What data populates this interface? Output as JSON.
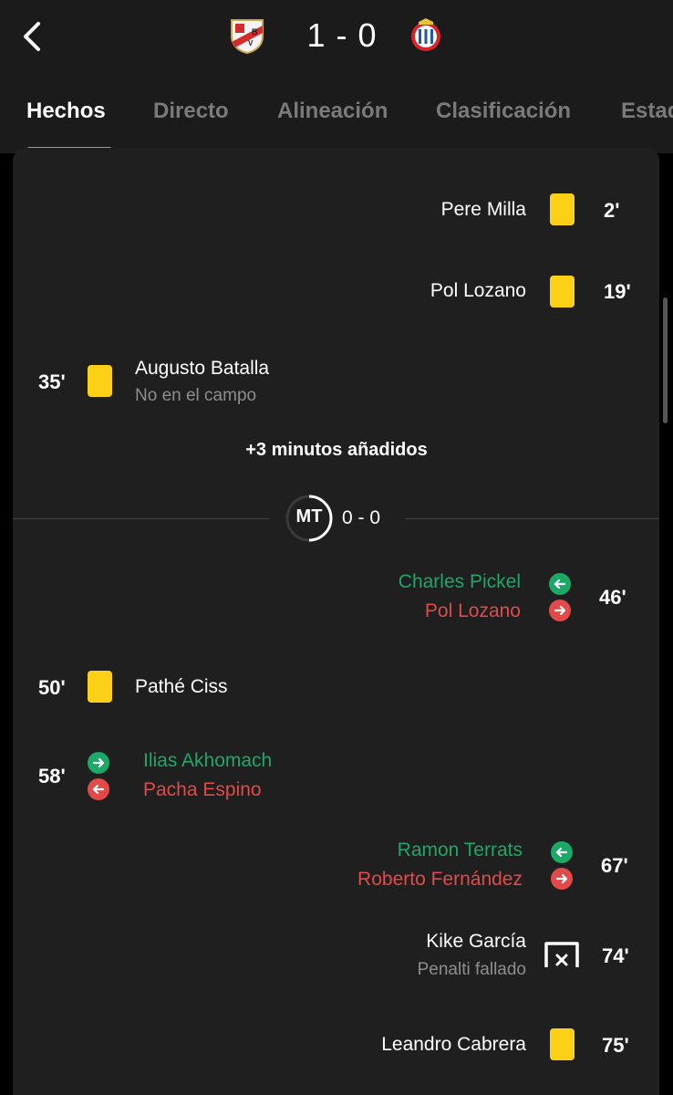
{
  "match": {
    "score": "1 - 0",
    "home_crest": "rayo-vallecano-crest-icon",
    "away_crest": "espanyol-crest-icon"
  },
  "tabs": [
    {
      "label": "Hechos",
      "active": true
    },
    {
      "label": "Directo"
    },
    {
      "label": "Alineación"
    },
    {
      "label": "Clasificación"
    },
    {
      "label": "Estad"
    }
  ],
  "events": {
    "e1": {
      "minute": "2'",
      "player": "Pere Milla",
      "type": "yellow-card",
      "side": "away"
    },
    "e2": {
      "minute": "19'",
      "player": "Pol Lozano",
      "type": "yellow-card",
      "side": "away"
    },
    "e3": {
      "minute": "35'",
      "player": "Augusto Batalla",
      "note": "No en el campo",
      "type": "yellow-card",
      "side": "home"
    },
    "added_time": "+3 minutos añadidos",
    "halftime": {
      "label": "MT",
      "score": "0 - 0"
    },
    "e4": {
      "minute": "46'",
      "player_in": "Charles Pickel",
      "player_out": "Pol Lozano",
      "type": "substitution",
      "side": "away"
    },
    "e5": {
      "minute": "50'",
      "player": "Pathé Ciss",
      "type": "yellow-card",
      "side": "home"
    },
    "e6": {
      "minute": "58'",
      "player_in": "Ilias Akhomach",
      "player_out": "Pacha Espino",
      "type": "substitution",
      "side": "home"
    },
    "e7": {
      "minute": "67'",
      "player_in": "Ramon Terrats",
      "player_out": "Roberto Fernández",
      "type": "substitution",
      "side": "away"
    },
    "e8": {
      "minute": "74'",
      "player": "Kike García",
      "note": "Penalti fallado",
      "type": "missed-penalty",
      "side": "away"
    },
    "e9": {
      "minute": "75'",
      "player": "Leandro Cabrera",
      "type": "yellow-card",
      "side": "away"
    }
  },
  "colors": {
    "accent": "#3ed45c",
    "yellow_card": "#fdd018",
    "sub_in": "#1ca866",
    "sub_out": "#e24a4a",
    "background": "#1f1f1f"
  }
}
